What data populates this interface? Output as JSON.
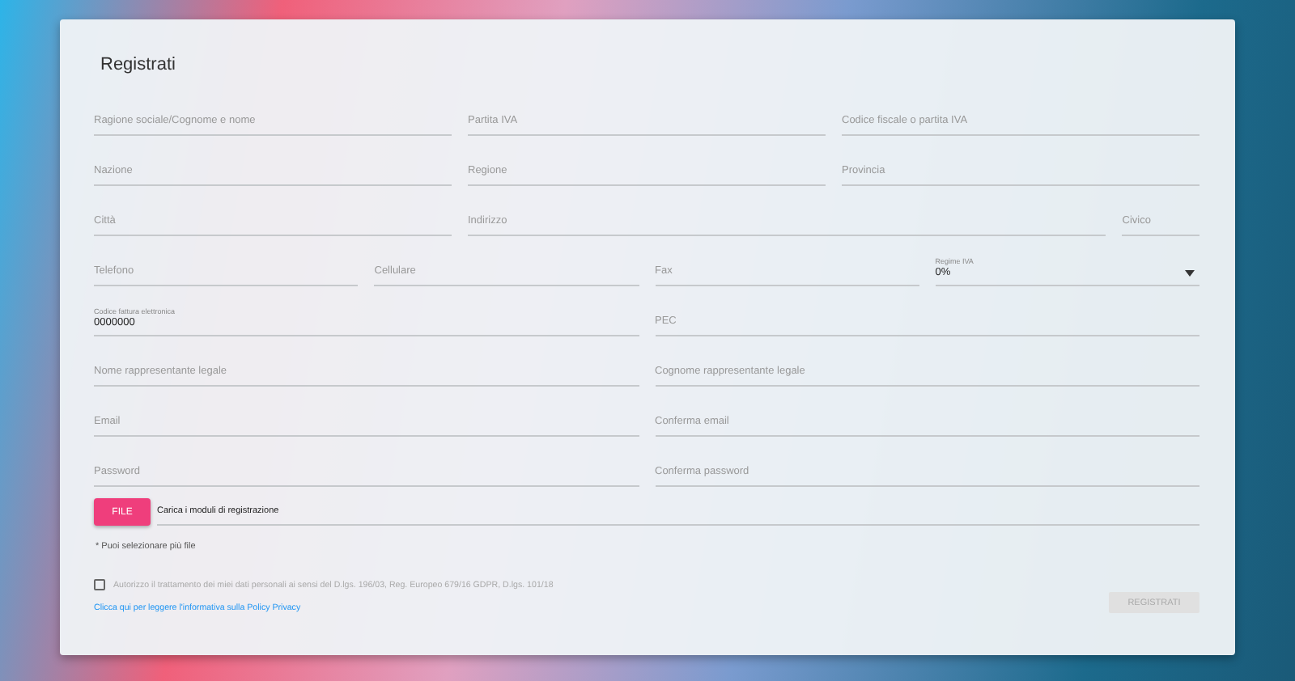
{
  "form": {
    "title": "Registrati",
    "rows": [
      [
        {
          "kind": "text",
          "placeholder": "Ragione sociale/Cognome e nome"
        },
        {
          "kind": "text",
          "placeholder": "Partita IVA"
        },
        {
          "kind": "text",
          "placeholder": "Codice fiscale o partita IVA"
        }
      ],
      [
        {
          "kind": "text",
          "placeholder": "Nazione"
        },
        {
          "kind": "text",
          "placeholder": "Regione"
        },
        {
          "kind": "text",
          "placeholder": "Provincia"
        }
      ],
      [
        {
          "kind": "text",
          "placeholder": "Città"
        },
        {
          "kind": "text",
          "placeholder": "Indirizzo"
        },
        {
          "kind": "text",
          "placeholder": "Civico"
        }
      ],
      [
        {
          "kind": "text",
          "placeholder": "Telefono"
        },
        {
          "kind": "text",
          "placeholder": "Cellulare"
        },
        {
          "kind": "text",
          "placeholder": "Fax"
        },
        {
          "kind": "select",
          "label": "Regime IVA",
          "value": "0%"
        }
      ],
      [
        {
          "kind": "text",
          "label": "Codice fattura elettronica",
          "value": "0000000"
        },
        {
          "kind": "text",
          "placeholder": "PEC"
        }
      ],
      [
        {
          "kind": "text",
          "placeholder": "Nome rappresentante legale"
        },
        {
          "kind": "text",
          "placeholder": "Cognome rappresentante legale"
        }
      ],
      [
        {
          "kind": "text",
          "placeholder": "Email"
        },
        {
          "kind": "text",
          "placeholder": "Conferma email"
        }
      ],
      [
        {
          "kind": "text",
          "placeholder": "Password"
        },
        {
          "kind": "text",
          "placeholder": "Conferma password"
        }
      ]
    ],
    "file": {
      "button": "FILE",
      "value": "Carica i moduli di registrazione",
      "hint": "* Puoi selezionare più file"
    },
    "consent": {
      "checked": false,
      "label": "Autorizzo il trattamento dei miei dati personali ai sensi del D.lgs. 196/03, Reg. Europeo 679/16 GDPR, D.lgs. 101/18"
    },
    "privacy_link": "Clicca qui per leggere l'informativa sulla Policy Privacy",
    "submit": {
      "label": "REGISTRATI",
      "disabled": true
    }
  }
}
